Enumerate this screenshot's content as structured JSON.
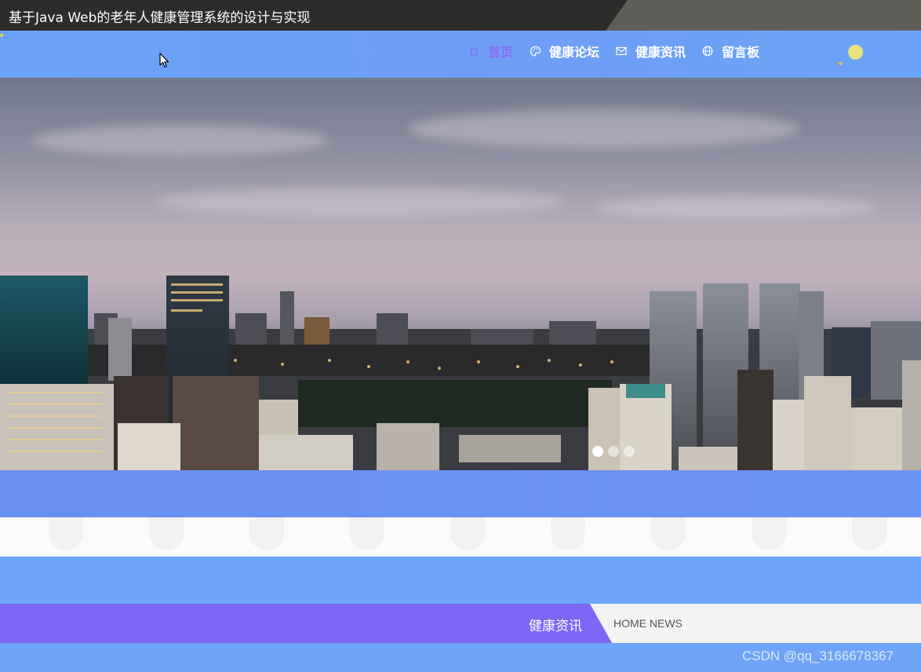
{
  "window": {
    "title": "基于Java Web的老年人健康管理系统的设计与实现"
  },
  "nav": {
    "items": [
      {
        "label": "首页",
        "icon": "home-icon",
        "active": true
      },
      {
        "label": "健康论坛",
        "icon": "palette-icon",
        "active": false
      },
      {
        "label": "健康资讯",
        "icon": "mail-icon",
        "active": false
      },
      {
        "label": "留言板",
        "icon": "globe-icon",
        "active": false
      }
    ]
  },
  "banner": {
    "slides": 3,
    "active_slide": 1
  },
  "section": {
    "title_cn": "健康资讯",
    "title_en": "HOME NEWS"
  },
  "watermark": "CSDN @qq_3166678367",
  "colors": {
    "nav_bg": "#6aa2f7",
    "active_nav": "#8a6cf5",
    "section_purple": "#7b66f5",
    "title_bar": "#2c2c2a"
  }
}
